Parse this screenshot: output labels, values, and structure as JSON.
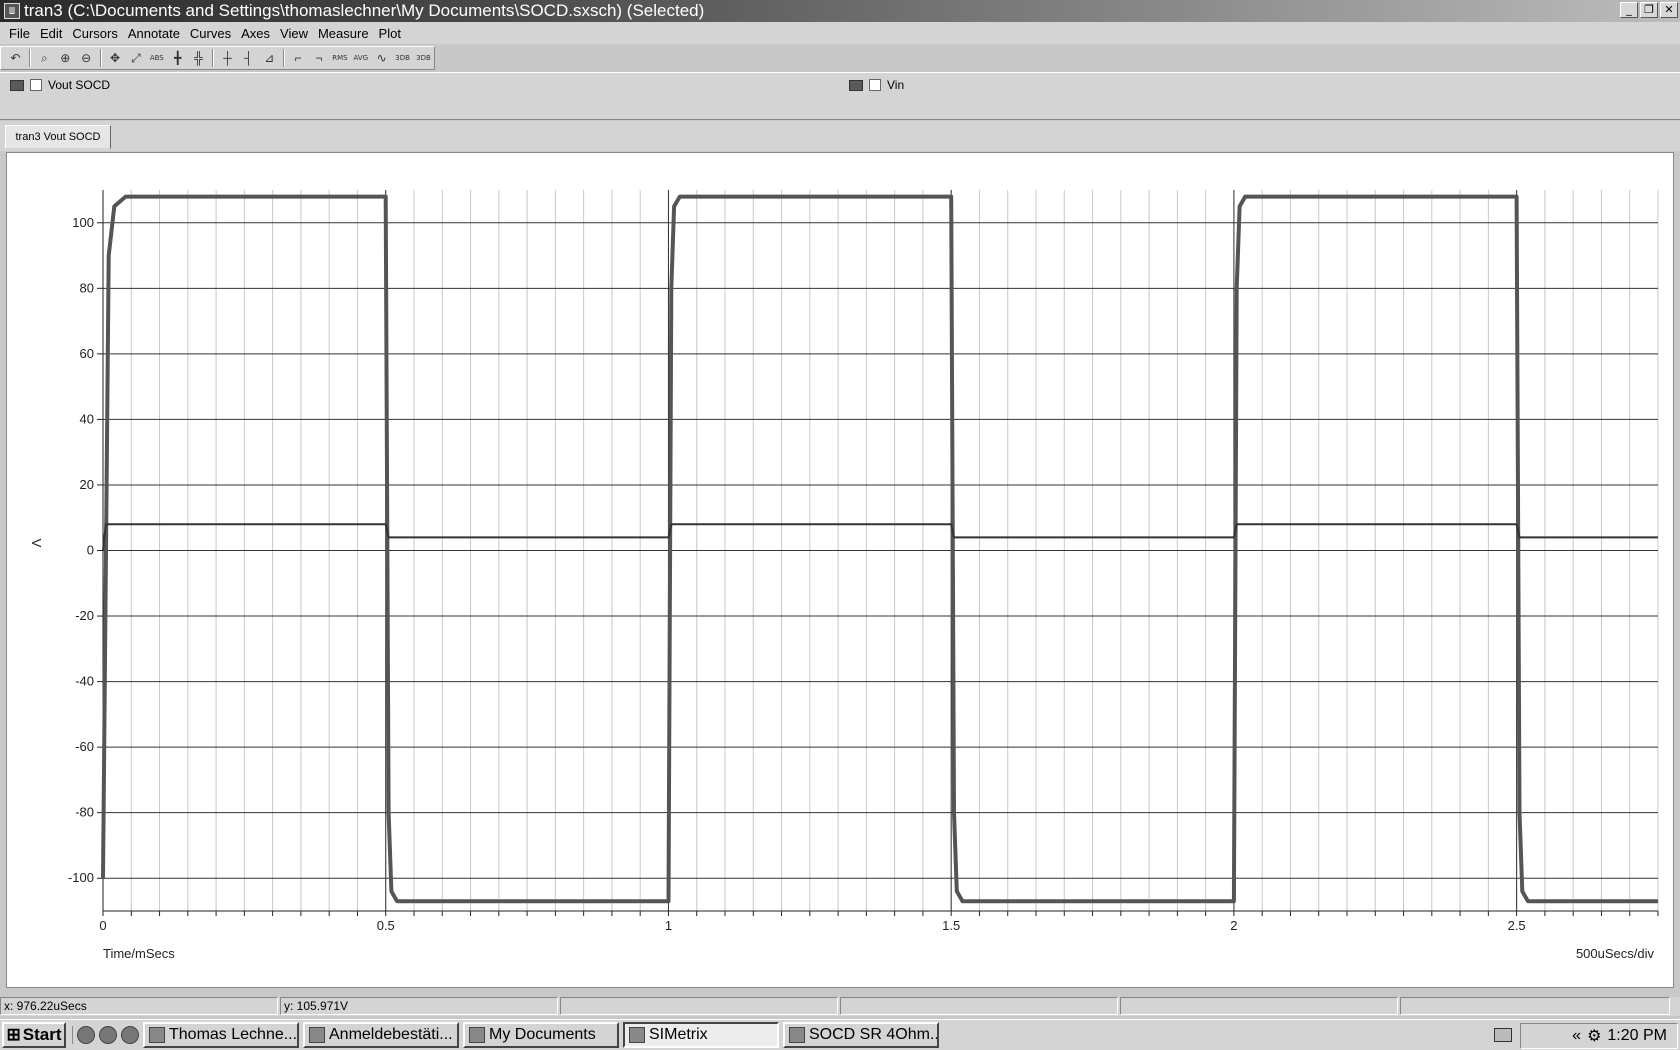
{
  "window": {
    "title": "tran3 (C:\\Documents and Settings\\thomaslechner\\My Documents\\SOCD.sxsch) (Selected)",
    "icon_name": "simetrix-app-icon",
    "buttons": {
      "minimize": "_",
      "restore": "❐",
      "close": "✕"
    }
  },
  "menu": [
    "File",
    "Edit",
    "Cursors",
    "Annotate",
    "Curves",
    "Axes",
    "View",
    "Measure",
    "Plot"
  ],
  "toolbar": {
    "icons": [
      "undo-icon",
      "zoom-box-icon",
      "zoom-in-icon",
      "zoom-out-icon",
      "pan-icon",
      "zoom-full-icon",
      "abs-icon",
      "cursor-icon",
      "cursor-pair-icon",
      "grid-icon",
      "grid-vertical-icon",
      "log-axis-icon",
      "rise-icon",
      "fall-icon",
      "rms-icon",
      "avg-icon",
      "measure-icon",
      "3db-low-icon",
      "3db-high-icon"
    ],
    "labels": {
      "abs": "ABS",
      "rms": "RMS",
      "avg": "AVG",
      "db1": "3DB",
      "db2": "3DB"
    }
  },
  "legend": [
    {
      "label": "Vout SOCD",
      "color": "#5a5a5a"
    },
    {
      "label": "Vin",
      "color": "#5a5a5a"
    }
  ],
  "tab": {
    "label": "tran3 Vout SOCD"
  },
  "chart_data": {
    "type": "line",
    "xlabel": "Time/mSecs",
    "ylabel": "V",
    "scale_label": "500uSecs/div",
    "xlim": [
      0,
      2.75
    ],
    "ylim": [
      -110,
      110
    ],
    "x_ticks": [
      "0",
      "0.5",
      "1",
      "1.5",
      "2",
      "2.5"
    ],
    "y_ticks": [
      "100",
      "80",
      "60",
      "40",
      "20",
      "0",
      "-20",
      "-40",
      "-60",
      "-80",
      "-100"
    ],
    "grid": true,
    "series": [
      {
        "name": "Vout SOCD",
        "x": [
          0,
          0.01,
          0.02,
          0.04,
          0.5,
          0.505,
          0.51,
          0.52,
          1.0,
          1.005,
          1.01,
          1.02,
          1.5,
          1.505,
          1.51,
          1.52,
          2.0,
          2.005,
          2.01,
          2.02,
          2.5,
          2.505,
          2.51,
          2.52,
          2.75
        ],
        "y": [
          -100,
          90,
          105,
          108,
          108,
          -80,
          -104,
          -107,
          -107,
          80,
          105,
          108,
          108,
          -80,
          -104,
          -107,
          -107,
          80,
          105,
          108,
          108,
          -80,
          -104,
          -107,
          -107
        ]
      },
      {
        "name": "Vin",
        "x": [
          0,
          0.005,
          0.5,
          0.505,
          1.0,
          1.005,
          1.5,
          1.505,
          2.0,
          2.005,
          2.5,
          2.505,
          2.75
        ],
        "y": [
          0,
          8,
          8,
          4,
          4,
          8,
          8,
          4,
          4,
          8,
          8,
          4,
          4
        ]
      }
    ]
  },
  "status": {
    "x": "x: 976.22uSecs",
    "y": "y: 105.971V"
  },
  "taskbar": {
    "start": "Start",
    "tasks": [
      {
        "label": "Thomas Lechne...",
        "active": false,
        "icon": "mail-icon"
      },
      {
        "label": "Anmeldebestäti...",
        "active": false,
        "icon": "pdf-icon"
      },
      {
        "label": "My Documents",
        "active": false,
        "icon": "folder-icon"
      },
      {
        "label": "SIMetrix",
        "active": true,
        "icon": "simetrix-icon"
      },
      {
        "label": "SOCD SR 4Ohm...",
        "active": false,
        "icon": "schematic-icon"
      }
    ],
    "tray_chevron": "«",
    "clock": "1:20 PM"
  }
}
